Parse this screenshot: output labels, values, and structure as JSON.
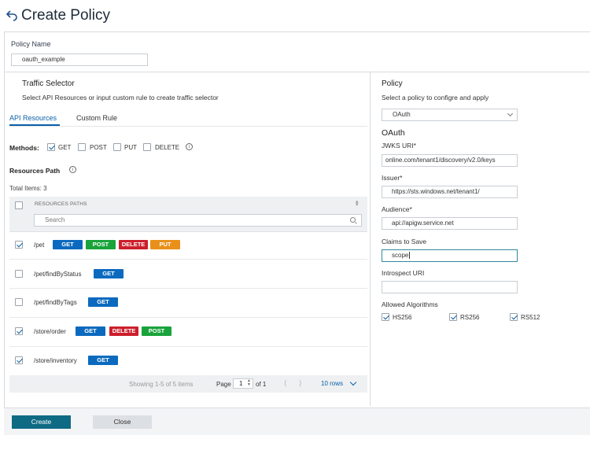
{
  "header": {
    "title": "Create Policy"
  },
  "policy_name": {
    "label": "Policy Name",
    "value": "oauth_example"
  },
  "traffic_selector": {
    "title": "Traffic Selector",
    "description": "Select API Resources or input custom rule to create traffic selector",
    "tabs": [
      {
        "label": "API Resources",
        "active": true
      },
      {
        "label": "Custom Rule",
        "active": false
      }
    ],
    "methods_label": "Methods:",
    "methods": [
      {
        "label": "GET",
        "checked": true
      },
      {
        "label": "POST",
        "checked": false
      },
      {
        "label": "PUT",
        "checked": false
      },
      {
        "label": "DELETE",
        "checked": false
      }
    ],
    "resources_path_label": "Resources Path",
    "total_items": "Total Items: 3",
    "table": {
      "column_header": "RESOURCES PATHS",
      "search_placeholder": "Search",
      "rows": [
        {
          "path": "/pet",
          "checked": true,
          "methods": [
            "GET",
            "POST",
            "DELETE",
            "PUT"
          ]
        },
        {
          "path": "/pet/findByStatus",
          "checked": false,
          "methods": [
            "GET"
          ]
        },
        {
          "path": "/pet/findByTags",
          "checked": false,
          "methods": [
            "GET"
          ]
        },
        {
          "path": "/store/order",
          "checked": true,
          "methods": [
            "GET",
            "DELETE",
            "POST"
          ]
        },
        {
          "path": "/store/inventory",
          "checked": true,
          "methods": [
            "GET"
          ]
        }
      ]
    },
    "pager": {
      "showing": "Showing 1-5 of 5 items",
      "page_label": "Page",
      "page_value": "1",
      "of_label": "of 1",
      "prev": "⟨",
      "next": "⟩",
      "rows_label": "10 rows"
    }
  },
  "policy": {
    "title": "Policy",
    "description": "Select a policy to configre and apply",
    "selected": "OAuth",
    "section_title": "OAuth",
    "fields": {
      "jwks_label": "JWKS URI*",
      "jwks_value": "online.com/tenant1/discovery/v2.0/keys",
      "issuer_label": "Issuer*",
      "issuer_value": "https://sts.windows.net/tenant1/",
      "audience_label": "Audience*",
      "audience_value": "api://apigw.service.net",
      "claims_label": "Claims to Save",
      "claims_value": "scope",
      "introspect_label": "Introspect URI",
      "introspect_value": ""
    },
    "algorithms_label": "Allowed Algorithms",
    "algorithms": [
      {
        "label": "HS256",
        "checked": true
      },
      {
        "label": "RS256",
        "checked": true
      },
      {
        "label": "RS512",
        "checked": true
      }
    ]
  },
  "footer": {
    "create_label": "Create",
    "close_label": "Close"
  },
  "colors": {
    "get": "#0b6abf",
    "post": "#19a33b",
    "delete": "#cc1f2b",
    "put": "#e8901a",
    "primary": "#0f6a84"
  }
}
